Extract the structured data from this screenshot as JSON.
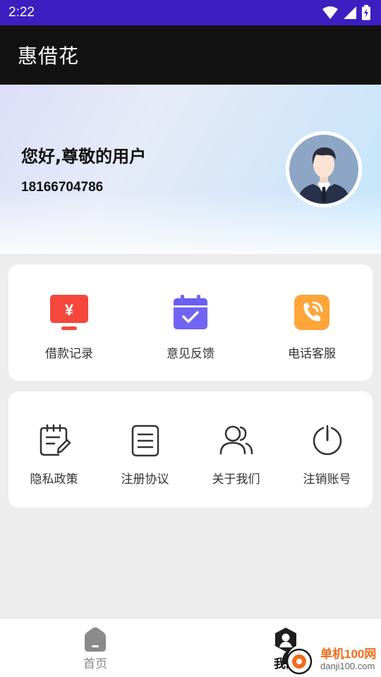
{
  "status_bar": {
    "time": "2:22"
  },
  "app_bar": {
    "title": "惠借花"
  },
  "profile": {
    "greeting": "您好,尊敬的用户",
    "phone": "18166704786"
  },
  "quick_actions": [
    {
      "label": "借款记录",
      "icon": "loan-record-icon"
    },
    {
      "label": "意见反馈",
      "icon": "calendar-check-icon"
    },
    {
      "label": "电话客服",
      "icon": "phone-icon"
    }
  ],
  "settings": [
    {
      "label": "隐私政策",
      "icon": "notepad-edit-icon"
    },
    {
      "label": "注册协议",
      "icon": "document-icon"
    },
    {
      "label": "关于我们",
      "icon": "users-icon"
    },
    {
      "label": "注销账号",
      "icon": "power-icon"
    }
  ],
  "bottom_nav": [
    {
      "label": "首页",
      "icon": "home-icon",
      "active": false
    },
    {
      "label": "我的",
      "icon": "profile-icon",
      "active": true
    }
  ],
  "watermark": {
    "title": "单机100网",
    "url": "danji100.com"
  },
  "colors": {
    "status_bar": "#3b1fc1",
    "app_bar": "#121212",
    "loan_red": "#f5473c",
    "feedback_purple": "#7163f4",
    "phone_orange": "#ffa53a"
  }
}
